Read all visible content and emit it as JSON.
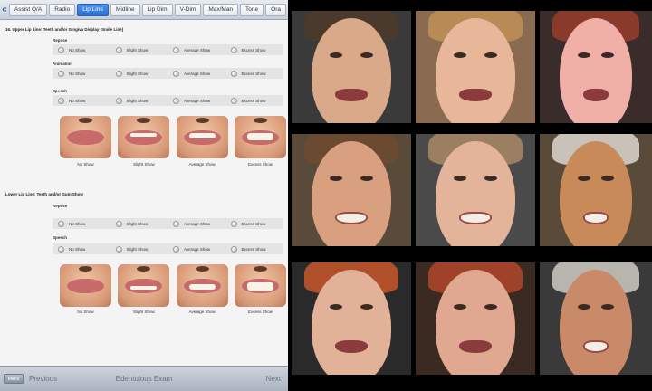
{
  "tabs": [
    "Assist Q/A",
    "Radio",
    "Lip Line",
    "Midline",
    "Lip Dim",
    "V-Dim",
    "Max/Man",
    "Tone",
    "Ora"
  ],
  "active_tab": "Lip Line",
  "upper": {
    "title": "16. Upper Lip Line: Teeth and/or Gingiva Display (Smile Line)",
    "groups": [
      {
        "label": "Repose",
        "options": [
          "No Show",
          "Slight Show",
          "Average Show",
          "Excess Show"
        ]
      },
      {
        "label": "Animation",
        "options": [
          "No Show",
          "Slight Show",
          "Average Show",
          "Excess Show"
        ]
      },
      {
        "label": "Speech",
        "options": [
          "No Show",
          "Slight Show",
          "Average Show",
          "Excess Show"
        ]
      }
    ],
    "captions": [
      "No Show",
      "Slight Show",
      "Average Show",
      "Excess Show"
    ]
  },
  "lower": {
    "title": "Lower Lip Line: Teeth and/or Gum Show",
    "groups": [
      {
        "label": "Repose",
        "options": [
          "No Show",
          "Slight Show",
          "Average Show",
          "Excess Show"
        ]
      },
      {
        "label": "Speech",
        "options": [
          "No Show",
          "Slight Show",
          "Average Show",
          "Excess Show"
        ]
      }
    ],
    "captions": [
      "No Show",
      "Slight Show",
      "Average Show",
      "Excess Show"
    ]
  },
  "bottom": {
    "menu": "Menu",
    "previous": "Previous",
    "title": "Edentulous Exam",
    "next": "Next"
  },
  "colors": {
    "tab_active": "#2e6fd0",
    "panel_bg": "#f4f4f4",
    "photo_bg": "#000000"
  }
}
